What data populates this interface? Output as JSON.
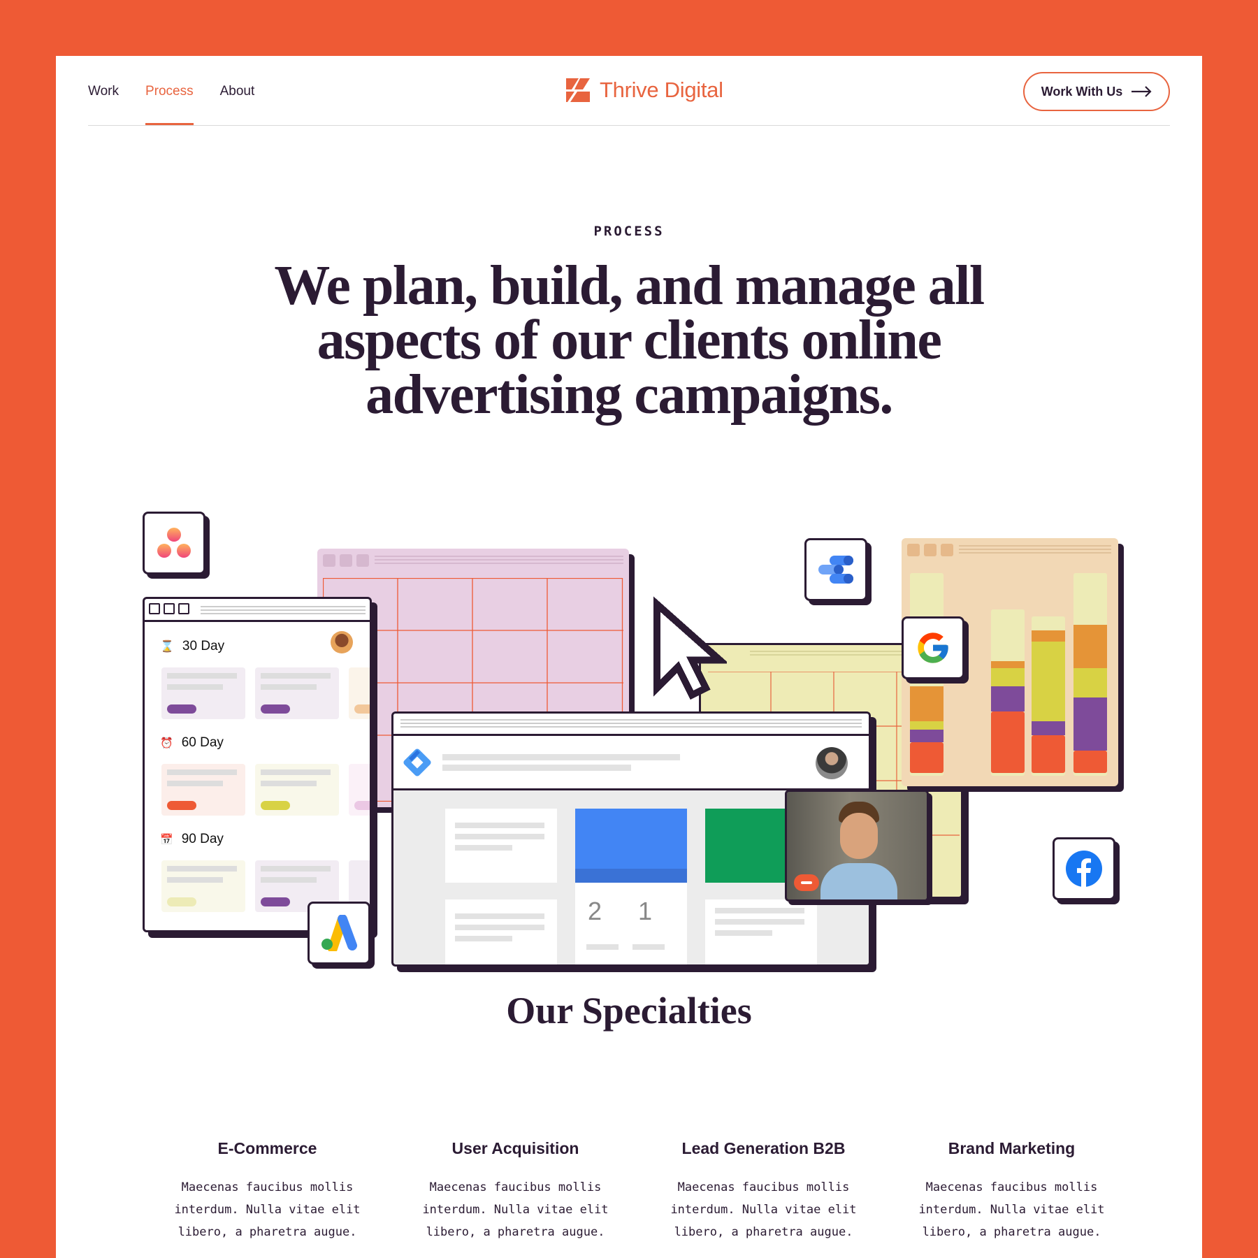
{
  "nav": {
    "links": [
      {
        "label": "Work",
        "active": false
      },
      {
        "label": "Process",
        "active": true
      },
      {
        "label": "About",
        "active": false
      }
    ],
    "logo_text": "Thrive Digital",
    "cta_label": "Work With Us"
  },
  "hero": {
    "eyebrow": "PROCESS",
    "headline": "We plan, build, and manage all aspects of our clients online advertising campaigns."
  },
  "illustration": {
    "timeline": [
      {
        "label": "30 Day",
        "icon": "hourglass-icon"
      },
      {
        "label": "60 Day",
        "icon": "alarm-clock-icon"
      },
      {
        "label": "90 Day",
        "icon": "calendar-icon"
      }
    ],
    "stats": [
      "2",
      "1"
    ],
    "badges": [
      "asana-icon",
      "google-ads-icon",
      "google-data-studio-icon",
      "google-icon",
      "facebook-icon",
      "google-tag-manager-icon"
    ]
  },
  "specialties": {
    "title": "Our Specialties",
    "items": [
      {
        "title": "E-Commerce",
        "body": "Maecenas faucibus mollis interdum. Nulla vitae elit libero, a pharetra augue."
      },
      {
        "title": "User Acquisition",
        "body": "Maecenas faucibus mollis interdum. Nulla vitae elit libero, a pharetra augue."
      },
      {
        "title": "Lead Generation B2B",
        "body": "Maecenas faucibus mollis interdum. Nulla vitae elit libero, a pharetra augue."
      },
      {
        "title": "Brand Marketing",
        "body": "Maecenas faucibus mollis interdum. Nulla vitae elit libero, a pharetra augue."
      }
    ]
  },
  "colors": {
    "brand": "#EE5A35",
    "ink": "#2B1B33",
    "accent": "#E8643F"
  }
}
